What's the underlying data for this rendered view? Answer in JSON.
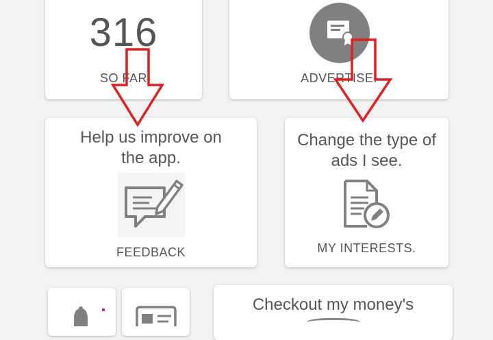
{
  "cards": {
    "so_far": {
      "value": "316",
      "label": "SO FAR"
    },
    "advertise": {
      "label": "ADVERTISE."
    },
    "feedback": {
      "description": "Help us improve on the app.",
      "label": "FEEDBACK"
    },
    "interests": {
      "description": "Change the type of ads I see.",
      "label": "MY INTERESTS."
    },
    "money": {
      "description": "Checkout my money's"
    }
  },
  "icons": {
    "advertise": "certificate-icon",
    "feedback": "feedback-edit-icon",
    "interests": "document-edit-icon",
    "notifications": "bell-icon",
    "profile": "id-card-icon"
  },
  "colors": {
    "background": "#f2f2f2",
    "card": "#ffffff",
    "text": "#555555",
    "icon_circle": "#808080",
    "annotation_arrow": "#e02020",
    "notify_dot": "#e0168c"
  }
}
